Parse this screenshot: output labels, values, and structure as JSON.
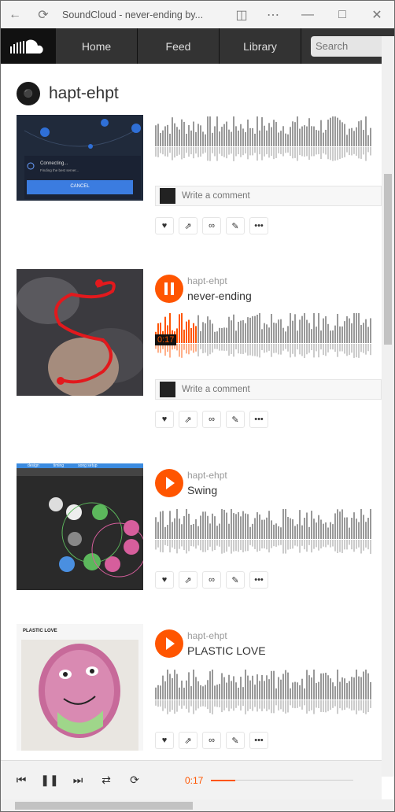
{
  "window": {
    "title": "SoundCloud - never-ending by..."
  },
  "nav": {
    "home": "Home",
    "feed": "Feed",
    "library": "Library",
    "search_placeholder": "Search"
  },
  "profile": {
    "username": "hapt-ehpt"
  },
  "tracks": [
    {
      "comment_placeholder": "Write a comment",
      "art_text": {
        "connecting": "Connecting...",
        "finding": "Finding the best server...",
        "cancel": "CANCEL"
      }
    },
    {
      "user": "hapt-ehpt",
      "title": "never-ending",
      "time": "0:17",
      "comment_placeholder": "Write a comment",
      "state": "playing",
      "progress": 0.19
    },
    {
      "user": "hapt-ehpt",
      "title": "Swing",
      "art_text": {
        "tabs": [
          "design",
          "timing",
          "song setup"
        ]
      }
    },
    {
      "user": "hapt-ehpt",
      "title": "PLASTIC LOVE",
      "art_text": {
        "label": "PLASTIC LOVE"
      }
    }
  ],
  "player": {
    "time": "0:17",
    "progress": 0.17
  },
  "colors": {
    "accent": "#ff5500",
    "nav_bg": "#333333"
  }
}
